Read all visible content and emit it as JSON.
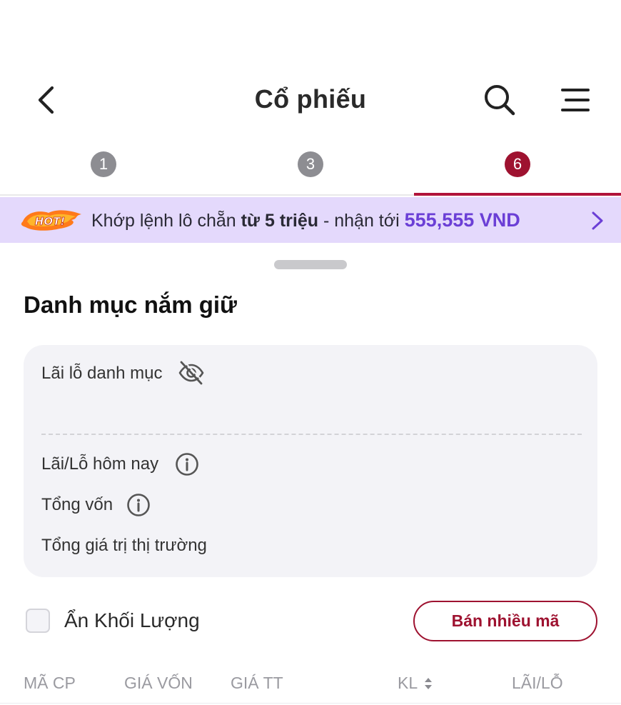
{
  "header": {
    "title": "Cổ phiếu",
    "back_icon": "chevron-left-icon",
    "search_icon": "search-icon",
    "menu_icon": "hamburger-menu-icon"
  },
  "tabs": [
    {
      "label": "1",
      "active": false
    },
    {
      "label": "3",
      "active": false
    },
    {
      "label": "6",
      "active": true
    }
  ],
  "promo": {
    "badge": "HOT!",
    "text_before": "Khớp lệnh lô chẵn ",
    "text_bold": "từ 5 triệu",
    "text_middle": " - nhận tới ",
    "amount": "555,555 VND",
    "background": "#e4d9fc",
    "amount_color": "#6b3fd6"
  },
  "portfolio": {
    "title": "Danh mục nắm giữ",
    "pnl_label": "Lãi lỗ danh mục",
    "today_pnl_label": "Lãi/Lỗ hôm nay",
    "total_capital_label": "Tổng vốn",
    "market_value_label": "Tổng giá trị thị trường"
  },
  "controls": {
    "hide_volume_label": "Ẩn Khối Lượng",
    "hide_volume_checked": false,
    "sell_multiple_label": "Bán nhiều mã"
  },
  "table": {
    "columns": [
      "MÃ CP",
      "GIÁ VỐN",
      "GIÁ TT",
      "KL",
      "LÃI/LỖ"
    ]
  },
  "colors": {
    "accent": "#9e1230",
    "tab_inactive": "#8d8d92"
  }
}
